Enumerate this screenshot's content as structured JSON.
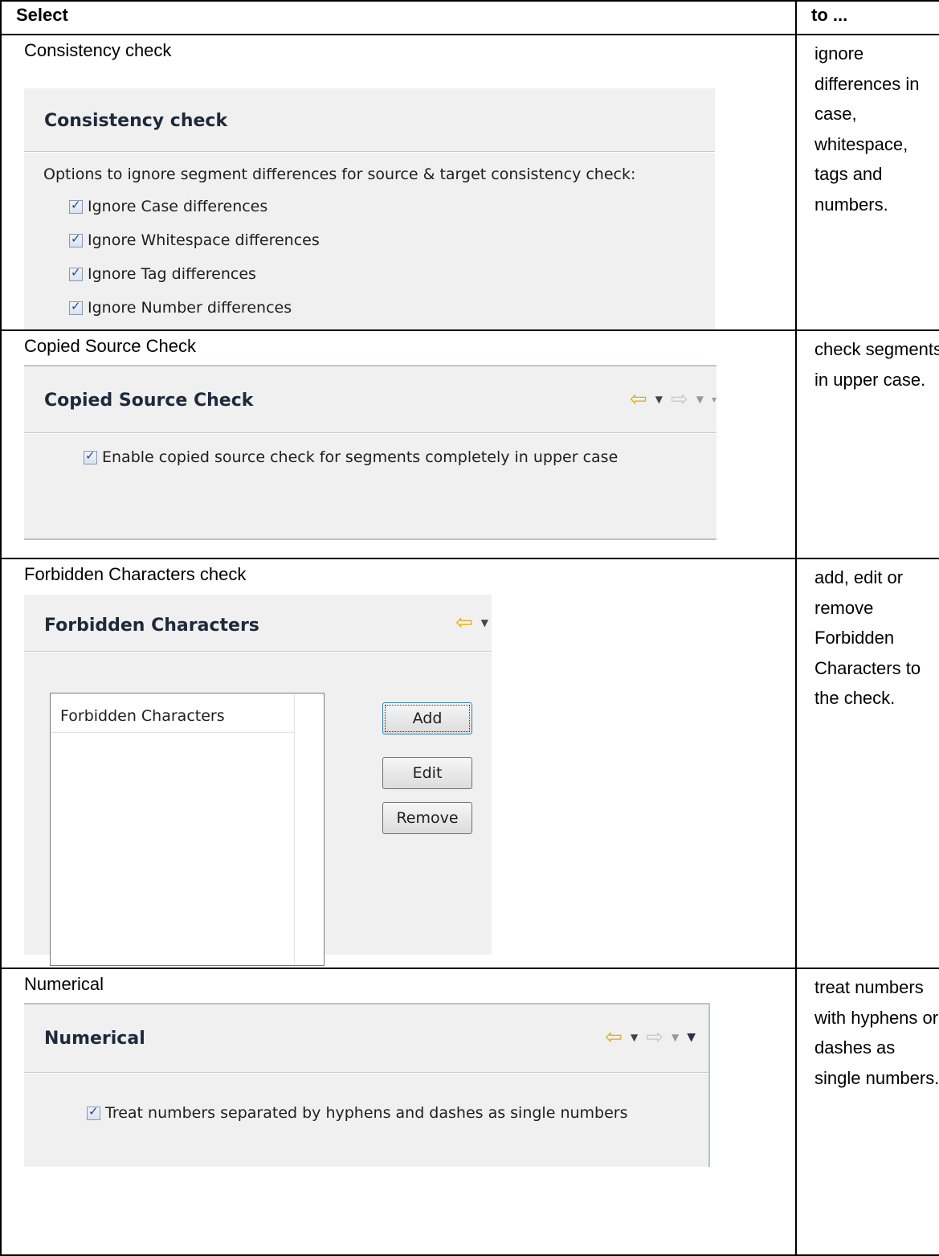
{
  "header": {
    "select": "Select",
    "to": "to ..."
  },
  "rows": [
    {
      "title": "Consistency check",
      "panel_title": "Consistency check",
      "intro": "Options to ignore segment differences for source & target consistency check:",
      "options": [
        "Ignore Case differences",
        "Ignore Whitespace differences",
        "Ignore Tag differences",
        "Ignore Number differences"
      ],
      "description": "ignore differences in  case, whitespace, tags and numbers."
    },
    {
      "title": "Copied Source Check",
      "panel_title": "Copied Source Check",
      "option": "Enable copied source check for segments completely in upper case",
      "description": "check segments in upper case."
    },
    {
      "title": "Forbidden Characters check",
      "panel_title": "Forbidden Characters",
      "list_header": "Forbidden Characters",
      "buttons": {
        "add": "Add",
        "edit": "Edit",
        "remove": "Remove"
      },
      "description": "add, edit or remove Forbidden Characters to the check."
    },
    {
      "title": "Numerical",
      "panel_title": "Numerical",
      "option": "Treat numbers separated by hyphens and dashes as single numbers",
      "description": "treat numbers with hyphens or dashes as single numbers."
    }
  ],
  "icons": [
    "back-arrow-icon",
    "forward-arrow-icon",
    "dropdown-triangle-icon",
    "view-menu-icon",
    "checkbox-checked-icon"
  ],
  "colors": {
    "panel_bg": "#f0f0f0",
    "back_arrow": "#e2a81a",
    "forward_arrow": "#c7c7c7"
  }
}
